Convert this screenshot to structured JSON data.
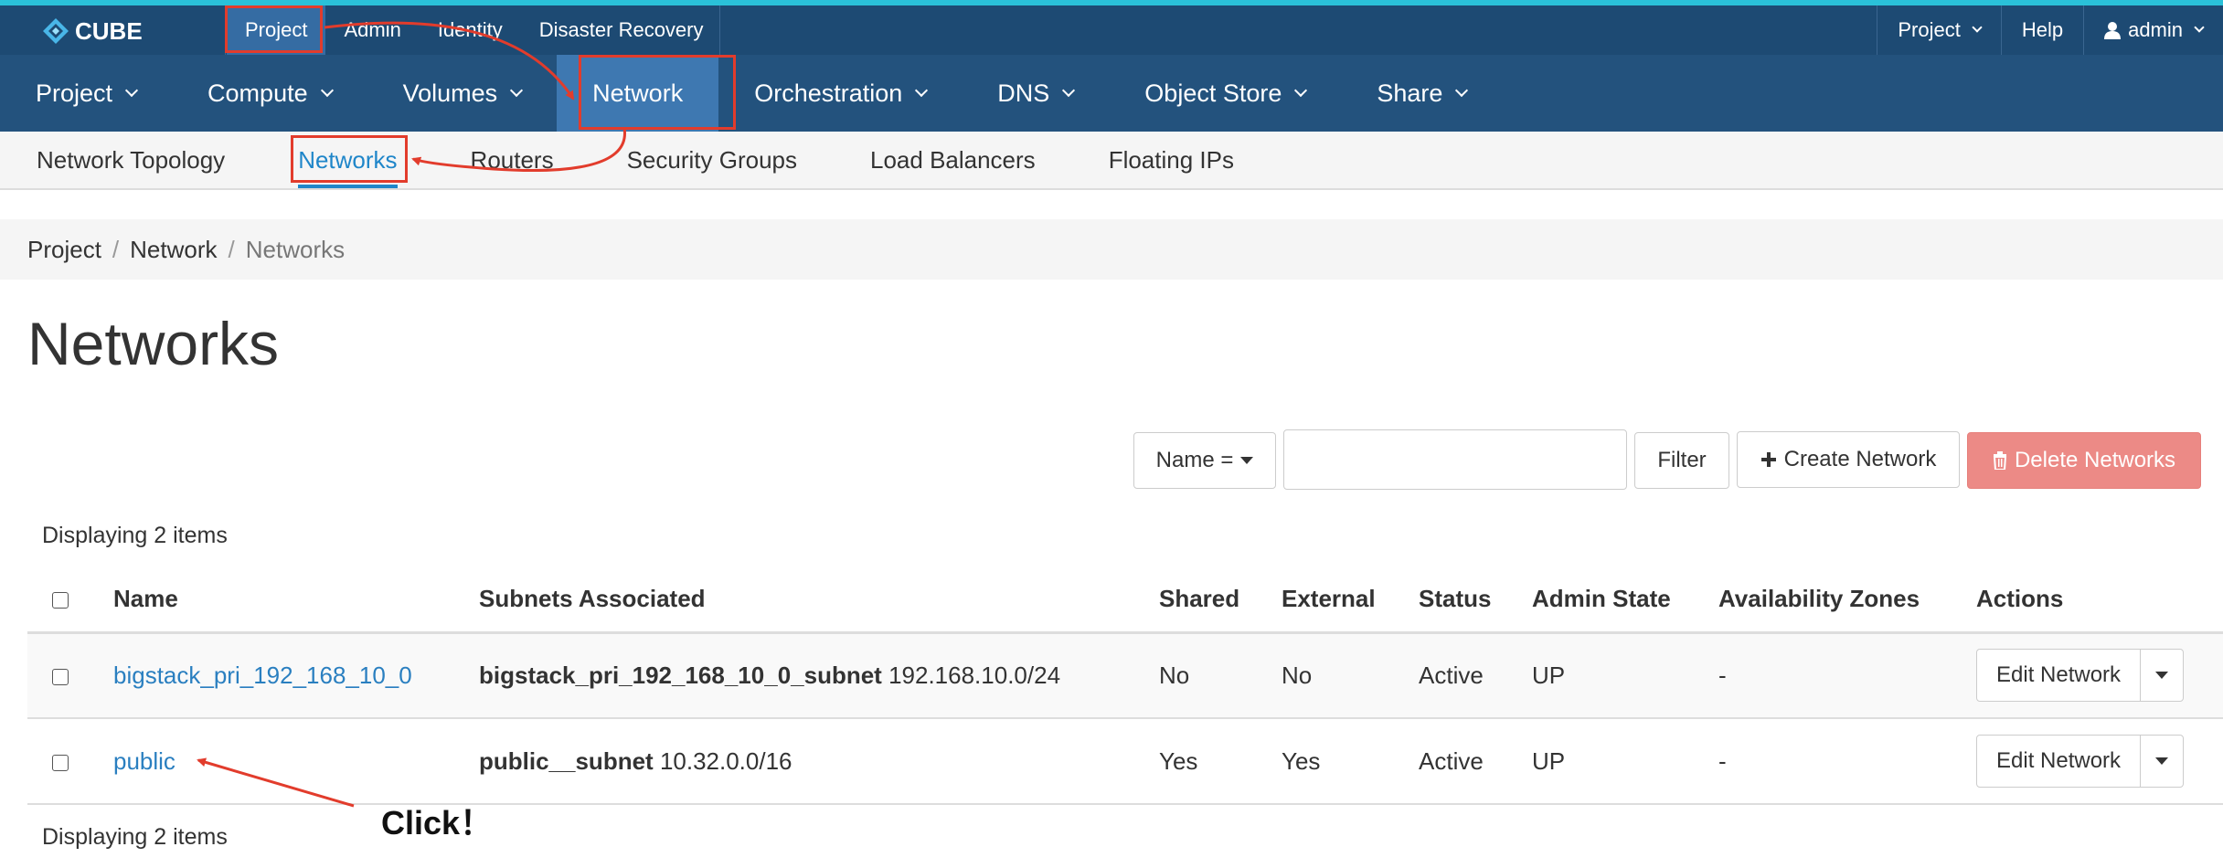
{
  "brand": {
    "name": "CUBE"
  },
  "top_nav": {
    "left_items": [
      "Project",
      "Admin",
      "Identity",
      "Disaster Recovery"
    ],
    "right_items": {
      "project": "Project",
      "help": "Help",
      "user": "admin"
    }
  },
  "main_nav": {
    "items": [
      "Project",
      "Compute",
      "Volumes",
      "Network",
      "Orchestration",
      "DNS",
      "Object Store",
      "Share"
    ],
    "active": "Network"
  },
  "sub_nav": {
    "items": [
      "Network Topology",
      "Networks",
      "Routers",
      "Security Groups",
      "Load Balancers",
      "Floating IPs"
    ],
    "active": "Networks"
  },
  "breadcrumb": [
    "Project",
    "Network",
    "Networks"
  ],
  "page": {
    "title": "Networks"
  },
  "toolbar": {
    "filter_field": "Name =",
    "search_value": "",
    "filter_label": "Filter",
    "create_label": "Create Network",
    "delete_label": "Delete Networks"
  },
  "table": {
    "count_text": "Displaying 2 items",
    "headers": [
      "Name",
      "Subnets Associated",
      "Shared",
      "External",
      "Status",
      "Admin State",
      "Availability Zones",
      "Actions"
    ],
    "rows": [
      {
        "name": "bigstack_pri_192_168_10_0",
        "subnet_name": "bigstack_pri_192_168_10_0_subnet",
        "subnet_cidr": "192.168.10.0/24",
        "shared": "No",
        "external": "No",
        "status": "Active",
        "admin_state": "UP",
        "zones": "-",
        "action": "Edit Network"
      },
      {
        "name": "public",
        "subnet_name": "public__subnet",
        "subnet_cidr": "10.32.0.0/16",
        "shared": "Yes",
        "external": "Yes",
        "status": "Active",
        "admin_state": "UP",
        "zones": "-",
        "action": "Edit Network"
      }
    ]
  },
  "annotation": {
    "text": "Click！",
    "color": "#e23c2c"
  },
  "colors": {
    "top_bar": "#1d4a73",
    "main_nav": "#23527d",
    "active_nav": "#3e78b1",
    "accent_line": "#2ac1d9",
    "link": "#2a7fc0",
    "danger": "#ec8a86"
  }
}
